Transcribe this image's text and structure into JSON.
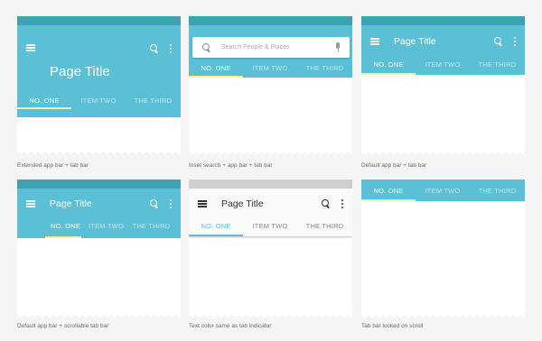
{
  "colors": {
    "app_bar": "#5bc0d5",
    "status_bar": "#3fa2b3",
    "indicator": "#f3f0b0",
    "background": "#f5f5f5"
  },
  "icons": [
    "menu-icon",
    "search-icon",
    "more-vert-icon",
    "mic-icon"
  ],
  "cards": [
    {
      "caption": "Extended app bar + tab bar",
      "title": "Page Title",
      "tabs": [
        "NO. ONE",
        "ITEM TWO",
        "THE THIRD"
      ],
      "active_tab": 0
    },
    {
      "caption": "Inset search + app bar + tab bar",
      "search_placeholder": "Search People  & Places",
      "tabs": [
        "NO. ONE",
        "ITEM TWO",
        "THE THIRD"
      ],
      "active_tab": 0
    },
    {
      "caption": "Default app bar + tab bar",
      "title": "Page Title",
      "tabs": [
        "NO. ONE",
        "ITEM TWO",
        "THE THIRD"
      ],
      "active_tab": 0
    },
    {
      "caption": "Default app bar + scrollable tab bar",
      "title": "Page Title",
      "tabs": [
        "NO. ONE",
        "ITEM TWO",
        "THE THIRD"
      ],
      "active_tab": 0
    },
    {
      "caption": "Text color same as tab indicator",
      "title": "Page Title",
      "tabs": [
        "NO. ONE",
        "ITEM TWO",
        "THE THIRD"
      ],
      "active_tab": 0
    },
    {
      "caption": "Tab bar locked on scroll",
      "tabs": [
        "NO. ONE",
        "ITEM TWO",
        "THE THIRD"
      ],
      "active_tab": 0
    }
  ]
}
